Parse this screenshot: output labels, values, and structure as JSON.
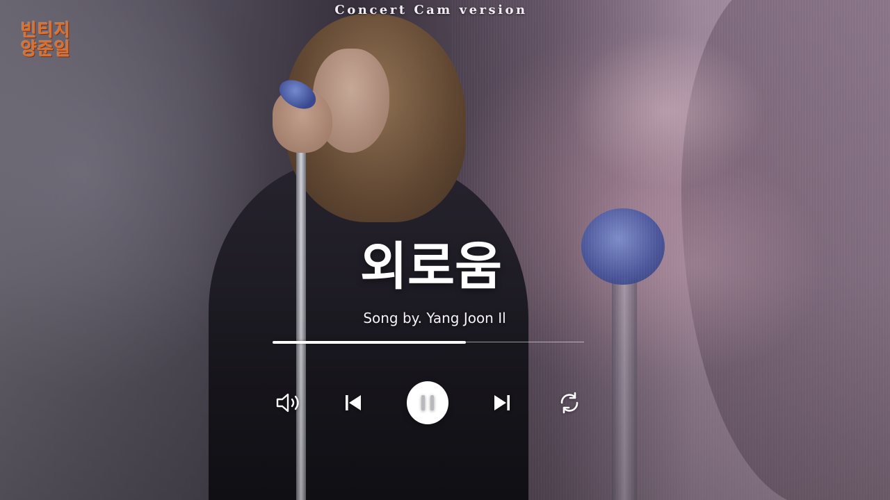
{
  "video": {
    "caption": "Concert Cam version"
  },
  "channel_logo": {
    "line1": "빈티지",
    "line2": "양준일"
  },
  "player": {
    "title": "외로움",
    "artist_line": "Song by. Yang Joon Il",
    "progress_fraction": 0.62,
    "state": "playing",
    "controls": {
      "volume": "volume-icon",
      "previous": "skip-previous-icon",
      "play_pause": "pause-icon",
      "next": "skip-next-icon",
      "repeat": "repeat-icon"
    }
  },
  "colors": {
    "logo_orange": "#d9702f",
    "text_white": "#ffffff"
  }
}
